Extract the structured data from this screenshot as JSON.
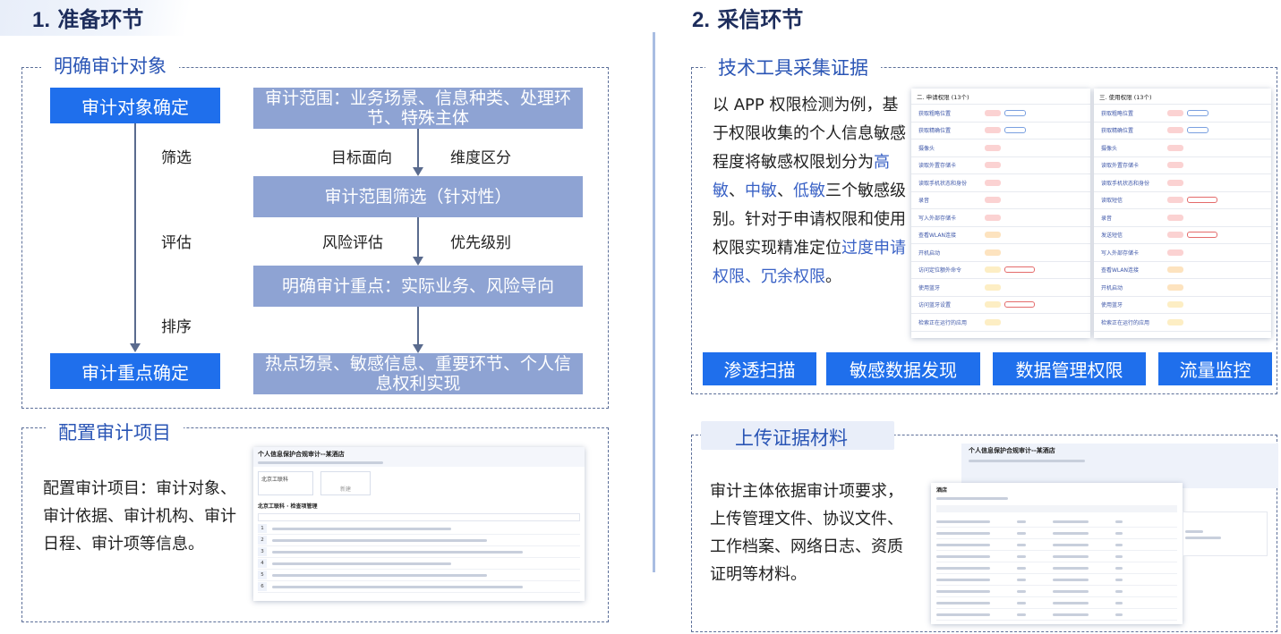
{
  "left_section": {
    "number": "1.",
    "title": "准备环节",
    "audit_object_box": {
      "label": "明确审计对象",
      "start_button": "审计对象确定",
      "end_button": "审计重点确定",
      "side_steps": [
        "筛选",
        "评估",
        "排序"
      ],
      "flow_boxes": [
        "审计范围：业务场景、信息种类、处理环节、特殊主体",
        "审计范围筛选（针对性）",
        "明确审计重点：实际业务、风险导向",
        "热点场景、敏感信息、重要环节、个人信息权利实现"
      ],
      "flow_labels": [
        [
          "目标面向",
          "维度区分"
        ],
        [
          "风险评估",
          "优先级别"
        ]
      ]
    },
    "config_box": {
      "label": "配置审计项目",
      "text": "配置审计项目：审计对象、审计依据、审计机构、审计日程、审计项等信息。",
      "screenshot": {
        "title": "个人信息保护合规审计--某酒店",
        "card_title": "北京工联科",
        "card2_label": "新建",
        "tab": "北京工联科 · 检查项管理",
        "items": [
          "1",
          "2",
          "3",
          "4",
          "5",
          "6"
        ]
      }
    }
  },
  "right_section": {
    "number": "2.",
    "title": "采信环节",
    "tools_box": {
      "label": "技术工具采集证据",
      "text_parts": [
        {
          "t": "以 APP 权限检测为例，基于权限收集的个人信息敏感程度将敏感权限划分为",
          "hl": false
        },
        {
          "t": "高敏",
          "hl": true
        },
        {
          "t": "、",
          "hl": false
        },
        {
          "t": "中敏",
          "hl": true
        },
        {
          "t": "、",
          "hl": false
        },
        {
          "t": "低敏",
          "hl": true
        },
        {
          "t": "三个敏感级别。针对于申请权限和使用权限实现精准定位",
          "hl": false
        },
        {
          "t": "过度申请权限、冗余权限",
          "hl": true
        },
        {
          "t": "。",
          "hl": false
        }
      ],
      "panel_requested": {
        "title": "二. 申请权限 (13个)",
        "rows": [
          {
            "name": "获取粗略位置",
            "level": "hi",
            "tag": "tag"
          },
          {
            "name": "获取精确位置",
            "level": "hi",
            "tag": "tag"
          },
          {
            "name": "摄像头",
            "level": "hi",
            "tag": ""
          },
          {
            "name": "读取外置存储卡",
            "level": "hi",
            "tag": ""
          },
          {
            "name": "读取手机状态和身份",
            "level": "hi",
            "tag": ""
          },
          {
            "name": "录音",
            "level": "hi",
            "tag": ""
          },
          {
            "name": "写入外部存储卡",
            "level": "hi",
            "tag": ""
          },
          {
            "name": "查看WLAN连接",
            "level": "mid",
            "tag": ""
          },
          {
            "name": "开机启动",
            "level": "mid",
            "tag": ""
          },
          {
            "name": "访问定位额外命令",
            "level": "lo",
            "tag": "redtag"
          },
          {
            "name": "使用蓝牙",
            "level": "lo",
            "tag": ""
          },
          {
            "name": "访问蓝牙设置",
            "level": "lo",
            "tag": "redtag"
          },
          {
            "name": "检索正在运行的应用",
            "level": "lo",
            "tag": ""
          }
        ]
      },
      "panel_used": {
        "title": "三. 使用权限 (13个)",
        "rows": [
          {
            "name": "获取粗略位置",
            "level": "hi",
            "tag": "tag"
          },
          {
            "name": "获取精确位置",
            "level": "hi",
            "tag": "tag"
          },
          {
            "name": "摄像头",
            "level": "hi",
            "tag": ""
          },
          {
            "name": "读取外置存储卡",
            "level": "hi",
            "tag": ""
          },
          {
            "name": "读取手机状态和身份",
            "level": "hi",
            "tag": ""
          },
          {
            "name": "读取短信",
            "level": "hi",
            "tag": "redtag"
          },
          {
            "name": "录音",
            "level": "hi",
            "tag": ""
          },
          {
            "name": "发送短信",
            "level": "hi",
            "tag": "redtag"
          },
          {
            "name": "写入外部存储卡",
            "level": "hi",
            "tag": ""
          },
          {
            "name": "查看WLAN连接",
            "level": "mid",
            "tag": ""
          },
          {
            "name": "开机启动",
            "level": "mid",
            "tag": ""
          },
          {
            "name": "使用蓝牙",
            "level": "lo",
            "tag": ""
          },
          {
            "name": "检索正在运行的应用",
            "level": "lo",
            "tag": ""
          }
        ]
      },
      "buttons": [
        "渗透扫描",
        "敏感数据发现",
        "数据管理权限",
        "流量监控"
      ]
    },
    "upload_box": {
      "label": "上传证据材料",
      "text": "审计主体依据审计项要求，上传管理文件、协议文件、工作档案、网络日志、资质证明等材料。",
      "screenshot": {
        "title": "个人信息保护合规审计--某酒店",
        "subtitle": "酒店",
        "rows": 9
      }
    }
  }
}
